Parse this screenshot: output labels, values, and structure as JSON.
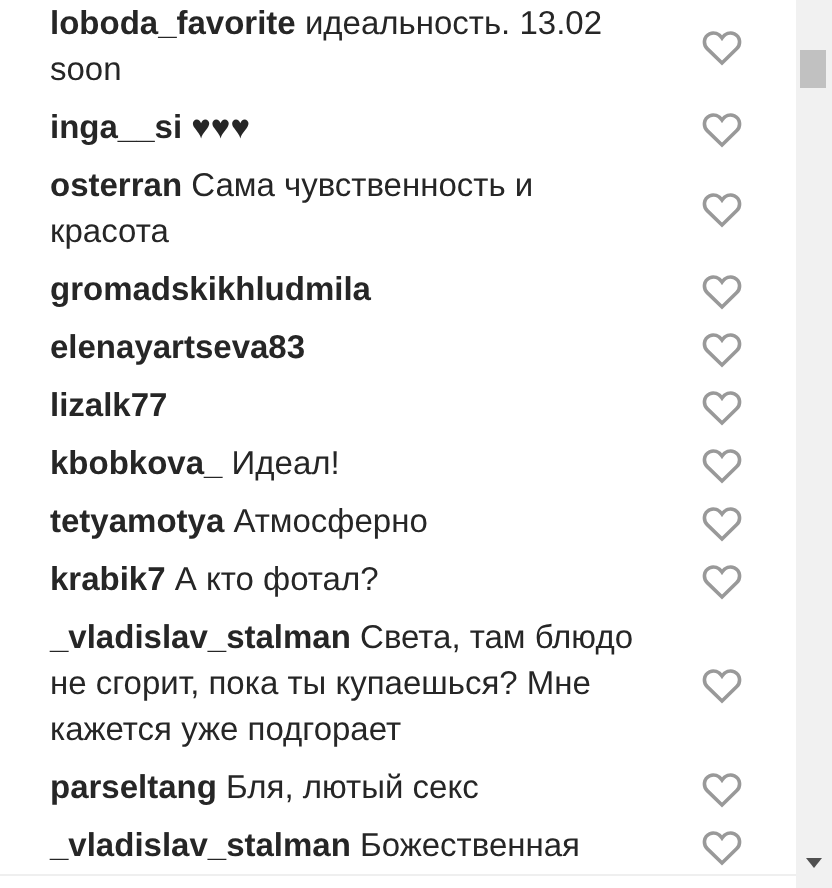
{
  "comments": [
    {
      "username": "loboda_favorite",
      "text": "идеальность. 13.02 soon",
      "liked": false
    },
    {
      "username": "inga__si",
      "text": "♥♥♥",
      "liked": false
    },
    {
      "username": "osterran",
      "text": "Сама чувственность и красота",
      "liked": false
    },
    {
      "username": "gromadskikhludmila",
      "liked": false
    },
    {
      "username": "elenayartseva83",
      "liked": false
    },
    {
      "username": "lizalk77",
      "liked": false
    },
    {
      "username": "kbobkova_",
      "text": "Идеал!",
      "liked": false
    },
    {
      "username": "tetyamotya",
      "text": "Атмосферно",
      "liked": false
    },
    {
      "username": "krabik7",
      "text": "А кто фотал?",
      "liked": false
    },
    {
      "username": "_vladislav_stalman",
      "text": "Света, там блюдо не сгорит, пока ты купаешься? Мне кажется уже подгорает",
      "liked": false
    },
    {
      "username": "parseltang",
      "text": "Бля, лютый секс",
      "liked": false
    },
    {
      "username": "_vladislav_stalman",
      "text": "Божественная",
      "liked": false
    }
  ]
}
